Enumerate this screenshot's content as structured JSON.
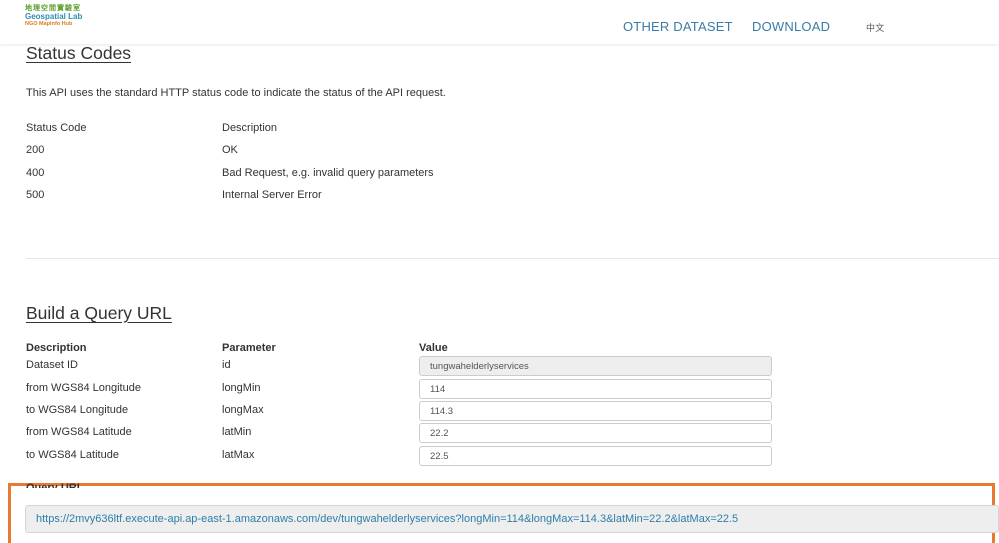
{
  "nav": {
    "logo_cn": "地理空間實驗室",
    "logo_en": "Geospatial Lab",
    "logo_sub": "NGO MapInfo Hub",
    "links": [
      "OTHER DATASET",
      "DOWNLOAD"
    ],
    "lang": "中文"
  },
  "status_section": {
    "title": "Status Codes",
    "intro": "This API uses the standard HTTP status code to indicate the status of the API request.",
    "header": {
      "code": "Status Code",
      "description": "Description"
    },
    "rows": [
      {
        "code": "200",
        "description": "OK"
      },
      {
        "code": "400",
        "description": "Bad Request, e.g. invalid query parameters"
      },
      {
        "code": "500",
        "description": "Internal Server Error"
      }
    ]
  },
  "query_section": {
    "title": "Build a Query URL",
    "headers": {
      "description": "Description",
      "parameter": "Parameter",
      "value": "Value"
    },
    "params": [
      {
        "description": "Dataset ID",
        "parameter": "id",
        "value": "tungwahelderlyservices"
      },
      {
        "description": "from WGS84 Longitude",
        "parameter": "longMin",
        "value": "114"
      },
      {
        "description": "to WGS84 Longitude",
        "parameter": "longMax",
        "value": "114.3"
      },
      {
        "description": "from WGS84 Latitude",
        "parameter": "latMin",
        "value": "22.2"
      },
      {
        "description": "to WGS84 Latitude",
        "parameter": "latMax",
        "value": "22.5"
      }
    ],
    "query_label": "Query URL",
    "query_url": "https://2mvy636ltf.execute-api.ap-east-1.amazonaws.com/dev/tungwahelderlyservices?longMin=114&longMax=114.3&latMin=22.2&latMax=22.5"
  },
  "colors": {
    "link": "#3a7ca5",
    "highlight": "#e8792f",
    "url_text": "#2d7fa7"
  }
}
